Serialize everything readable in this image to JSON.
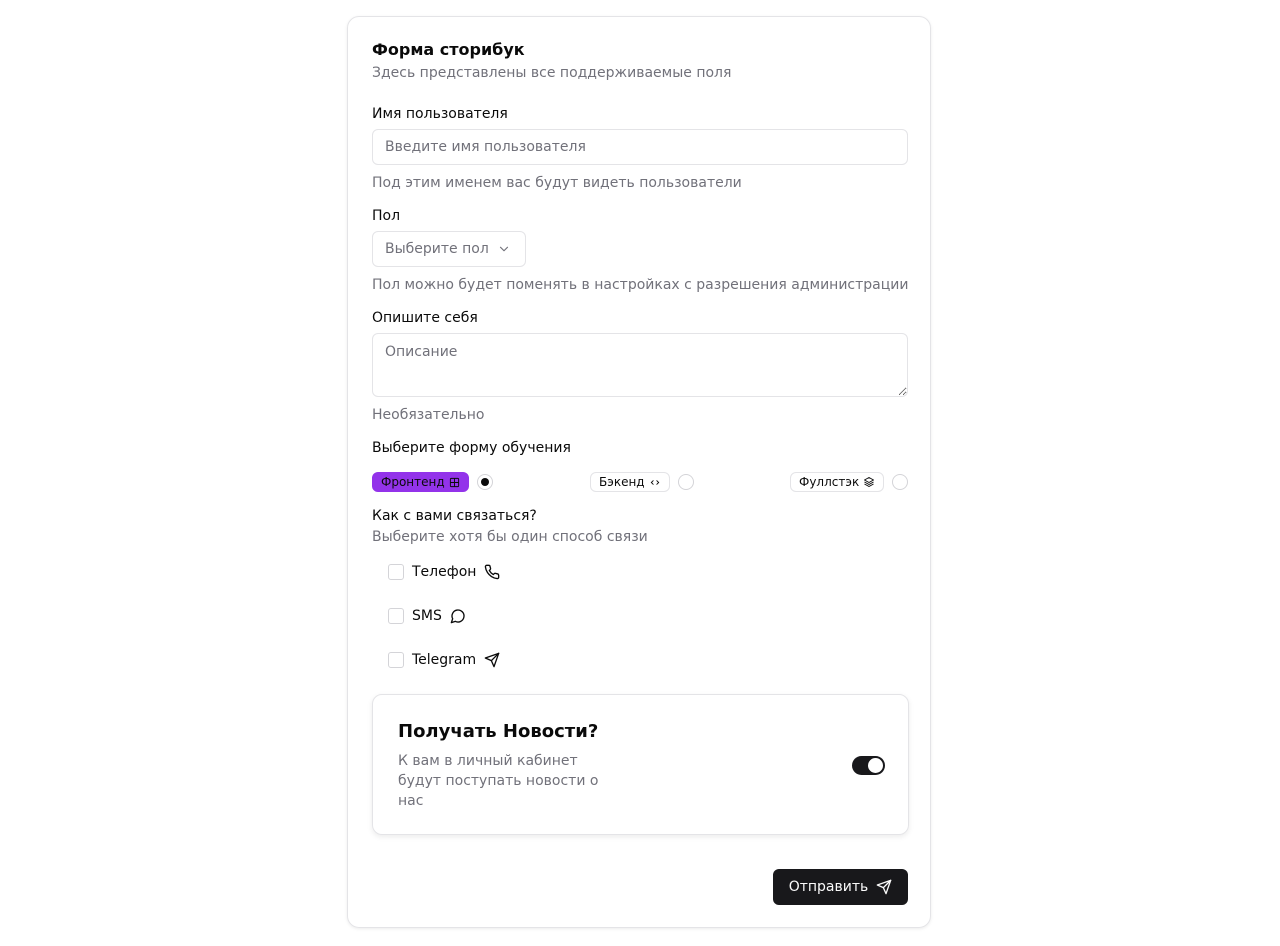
{
  "form": {
    "title": "Форма сторибук",
    "subtitle": "Здесь представлены все поддерживаемые поля"
  },
  "username": {
    "label": "Имя пользователя",
    "placeholder": "Введите имя пользователя",
    "hint": "Под этим именем вас будут видеть пользователи"
  },
  "gender": {
    "label": "Пол",
    "placeholder": "Выберите пол",
    "hint": "Пол можно будет поменять в настройках с разрешения администрации"
  },
  "about": {
    "label": "Опишите себя",
    "placeholder": "Описание",
    "hint": "Необязательно"
  },
  "education": {
    "label": "Выберите форму обучения",
    "options": [
      {
        "label": "Фронтенд",
        "icon": "layout-grid-icon",
        "selected": true
      },
      {
        "label": "Бэкенд",
        "icon": "code-icon",
        "selected": false
      },
      {
        "label": "Фуллстэк",
        "icon": "layers-icon",
        "selected": false
      }
    ]
  },
  "contact": {
    "label": "Как с вами связаться?",
    "hint": "Выберите хотя бы один способ связи",
    "options": [
      {
        "label": "Телефон",
        "icon": "phone-icon",
        "checked": false
      },
      {
        "label": "SMS",
        "icon": "message-circle-icon",
        "checked": false
      },
      {
        "label": "Telegram",
        "icon": "send-icon",
        "checked": false
      }
    ]
  },
  "news": {
    "title": "Получать Новости?",
    "description": "К вам в личный кабинет будут поступать новости о нас",
    "enabled": true
  },
  "submit": {
    "label": "Отправить",
    "icon": "send-icon"
  },
  "colors": {
    "accent": "#9333ea",
    "primary": "#18181b",
    "muted": "#71717a",
    "border": "#e4e4e7"
  }
}
